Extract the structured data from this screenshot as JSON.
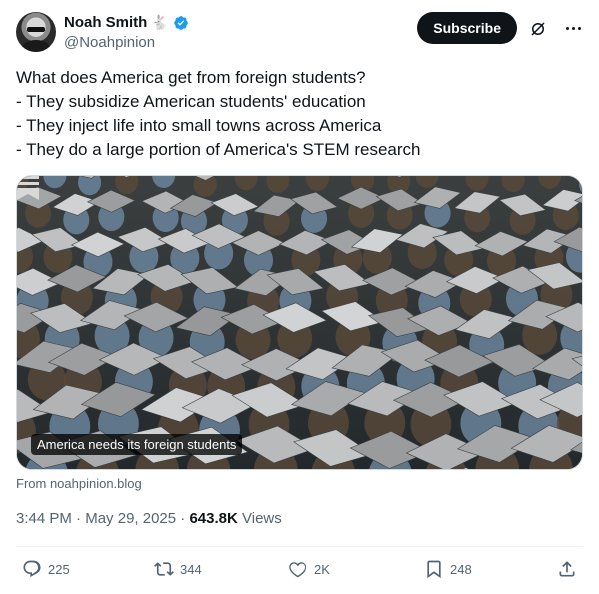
{
  "author": {
    "name": "Noah Smith",
    "handle": "@Noahpinion",
    "badge_icon": "rabbit-icon",
    "verified_color": "#1d9bf0"
  },
  "header": {
    "subscribe_label": "Subscribe"
  },
  "tweet": {
    "lines": [
      "What does America get from foreign students?",
      "- They subsidize American students' education",
      "- They inject life into small towns across America",
      "- They do a large portion of America's STEM research"
    ]
  },
  "card": {
    "title": "America needs its foreign students",
    "source": "From noahpinion.blog"
  },
  "meta": {
    "time": "3:44 PM",
    "sep1": " · ",
    "date": "May 29, 2025",
    "sep2": " · ",
    "views_count": "643.8K",
    "views_label": " Views"
  },
  "actions": {
    "replies": "225",
    "reposts": "344",
    "likes": "2K",
    "bookmarks": "248"
  }
}
